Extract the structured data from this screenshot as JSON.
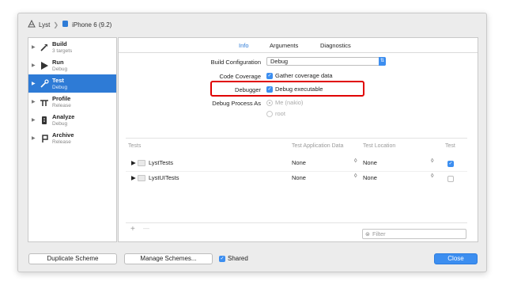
{
  "window": {
    "breadcrumb": {
      "scheme": "Lyst",
      "destination": "iPhone 6 (9.2)"
    }
  },
  "sidebar": {
    "items": [
      {
        "name": "Build",
        "sub": "3 targets",
        "icon": "hammer-icon"
      },
      {
        "name": "Run",
        "sub": "Debug",
        "icon": "play-icon"
      },
      {
        "name": "Test",
        "sub": "Debug",
        "icon": "wrench-icon",
        "selected": true
      },
      {
        "name": "Profile",
        "sub": "Release",
        "icon": "profile-icon"
      },
      {
        "name": "Analyze",
        "sub": "Debug",
        "icon": "analyze-icon"
      },
      {
        "name": "Archive",
        "sub": "Release",
        "icon": "archive-icon"
      }
    ]
  },
  "tabs": {
    "info": "Info",
    "arguments": "Arguments",
    "diagnostics": "Diagnostics",
    "active": "Info"
  },
  "form": {
    "build_configuration_label": "Build Configuration",
    "build_configuration_value": "Debug",
    "code_coverage_label": "Code Coverage",
    "code_coverage_text": "Gather coverage data",
    "code_coverage_checked": true,
    "debugger_label": "Debugger",
    "debugger_text": "Debug executable",
    "debugger_checked": true,
    "debug_process_as_label": "Debug Process As",
    "debug_process_me": "Me (nakio)",
    "debug_process_root": "root"
  },
  "table": {
    "headers": {
      "tests": "Tests",
      "app_data": "Test Application Data",
      "location": "Test Location",
      "test": "Test"
    },
    "rows": [
      {
        "name": "LystTests",
        "app_data": "None",
        "location": "None",
        "checked": true
      },
      {
        "name": "LystUITests",
        "app_data": "None",
        "location": "None",
        "checked": false
      }
    ],
    "add": "+",
    "remove": "—",
    "filter_placeholder": "Filter"
  },
  "footer": {
    "duplicate": "Duplicate Scheme",
    "manage": "Manage Schemes...",
    "shared": "Shared",
    "shared_checked": true,
    "close": "Close"
  },
  "colors": {
    "accent": "#2e7bd6",
    "highlight": "#e00000"
  }
}
